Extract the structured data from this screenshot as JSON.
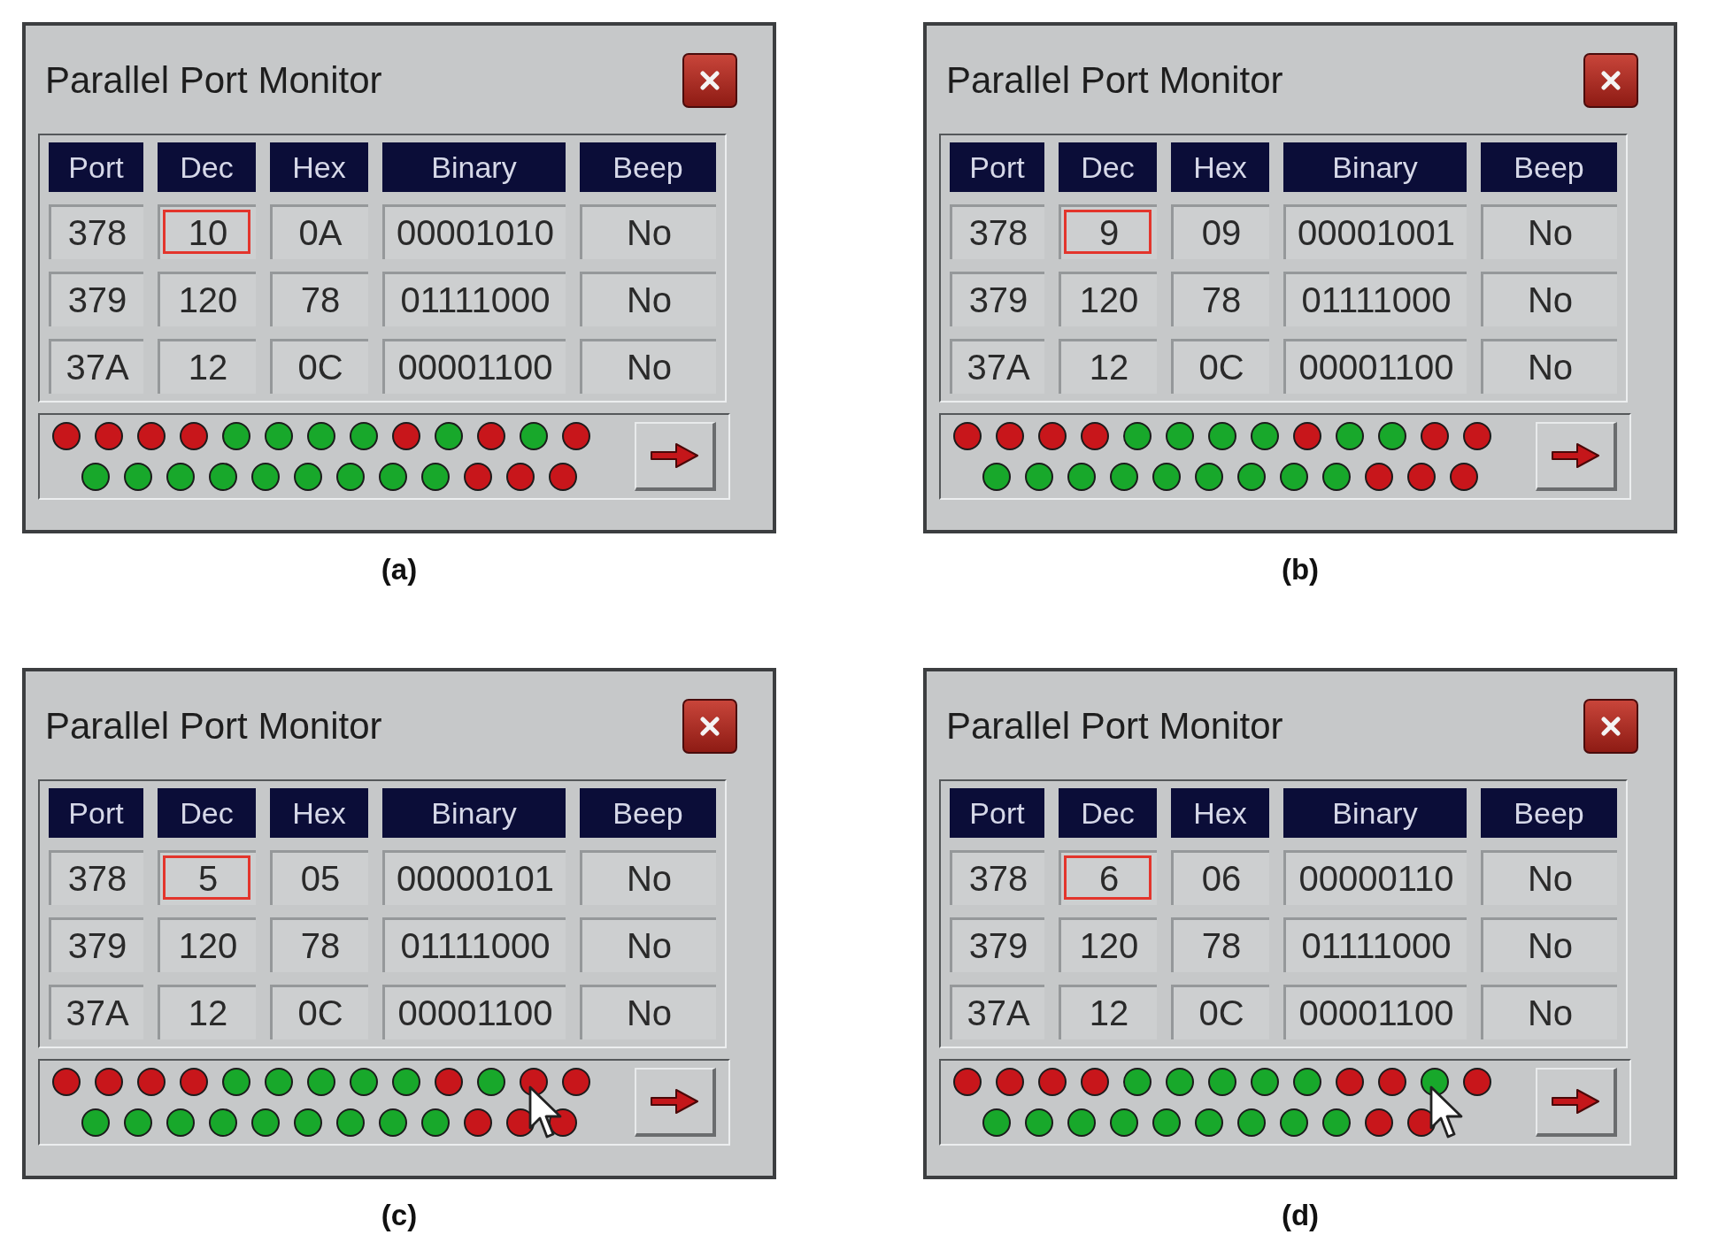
{
  "figures": [
    {
      "caption": "(a)",
      "window": {
        "title": "Parallel Port Monitor",
        "columns": [
          "Port",
          "Dec",
          "Hex",
          "Binary",
          "Beep"
        ],
        "rows": [
          {
            "port": "378",
            "dec": "10",
            "hex": "0A",
            "binary": "00001010",
            "beep": "No",
            "dec_highlighted": true
          },
          {
            "port": "379",
            "dec": "120",
            "hex": "78",
            "binary": "01111000",
            "beep": "No",
            "dec_highlighted": false
          },
          {
            "port": "37A",
            "dec": "12",
            "hex": "0C",
            "binary": "00001100",
            "beep": "No",
            "dec_highlighted": false
          }
        ],
        "leds_top": [
          {
            "color": "#c8161b",
            "hovered": false
          },
          {
            "color": "#c8161b",
            "hovered": false
          },
          {
            "color": "#c8161b",
            "hovered": false
          },
          {
            "color": "#c8161b",
            "hovered": false
          },
          {
            "color": "#18a82b",
            "hovered": false
          },
          {
            "color": "#18a82b",
            "hovered": false
          },
          {
            "color": "#18a82b",
            "hovered": false
          },
          {
            "color": "#18a82b",
            "hovered": false
          },
          {
            "color": "#c8161b",
            "hovered": false
          },
          {
            "color": "#18a82b",
            "hovered": false
          },
          {
            "color": "#c8161b",
            "hovered": false
          },
          {
            "color": "#18a82b",
            "hovered": false
          },
          {
            "color": "#c8161b",
            "hovered": false
          }
        ],
        "leds_bottom": [
          {
            "color": "#18a82b"
          },
          {
            "color": "#18a82b"
          },
          {
            "color": "#18a82b"
          },
          {
            "color": "#18a82b"
          },
          {
            "color": "#18a82b"
          },
          {
            "color": "#18a82b"
          },
          {
            "color": "#18a82b"
          },
          {
            "color": "#18a82b"
          },
          {
            "color": "#18a82b"
          },
          {
            "color": "#c8161b"
          },
          {
            "color": "#c8161b"
          },
          {
            "color": "#c8161b"
          }
        ]
      }
    },
    {
      "caption": "(b)",
      "window": {
        "title": "Parallel Port Monitor",
        "columns": [
          "Port",
          "Dec",
          "Hex",
          "Binary",
          "Beep"
        ],
        "rows": [
          {
            "port": "378",
            "dec": "9",
            "hex": "09",
            "binary": "00001001",
            "beep": "No",
            "dec_highlighted": true
          },
          {
            "port": "379",
            "dec": "120",
            "hex": "78",
            "binary": "01111000",
            "beep": "No",
            "dec_highlighted": false
          },
          {
            "port": "37A",
            "dec": "12",
            "hex": "0C",
            "binary": "00001100",
            "beep": "No",
            "dec_highlighted": false
          }
        ],
        "leds_top": [
          {
            "color": "#c8161b",
            "hovered": false
          },
          {
            "color": "#c8161b",
            "hovered": false
          },
          {
            "color": "#c8161b",
            "hovered": false
          },
          {
            "color": "#c8161b",
            "hovered": false
          },
          {
            "color": "#18a82b",
            "hovered": false
          },
          {
            "color": "#18a82b",
            "hovered": false
          },
          {
            "color": "#18a82b",
            "hovered": false
          },
          {
            "color": "#18a82b",
            "hovered": false
          },
          {
            "color": "#c8161b",
            "hovered": false
          },
          {
            "color": "#18a82b",
            "hovered": false
          },
          {
            "color": "#18a82b",
            "hovered": false
          },
          {
            "color": "#c8161b",
            "hovered": false
          },
          {
            "color": "#c8161b",
            "hovered": false
          }
        ],
        "leds_bottom": [
          {
            "color": "#18a82b"
          },
          {
            "color": "#18a82b"
          },
          {
            "color": "#18a82b"
          },
          {
            "color": "#18a82b"
          },
          {
            "color": "#18a82b"
          },
          {
            "color": "#18a82b"
          },
          {
            "color": "#18a82b"
          },
          {
            "color": "#18a82b"
          },
          {
            "color": "#18a82b"
          },
          {
            "color": "#c8161b"
          },
          {
            "color": "#c8161b"
          },
          {
            "color": "#c8161b"
          }
        ]
      }
    },
    {
      "caption": "(c)",
      "window": {
        "title": "Parallel Port Monitor",
        "columns": [
          "Port",
          "Dec",
          "Hex",
          "Binary",
          "Beep"
        ],
        "rows": [
          {
            "port": "378",
            "dec": "5",
            "hex": "05",
            "binary": "00000101",
            "beep": "No",
            "dec_highlighted": true
          },
          {
            "port": "379",
            "dec": "120",
            "hex": "78",
            "binary": "01111000",
            "beep": "No",
            "dec_highlighted": false
          },
          {
            "port": "37A",
            "dec": "12",
            "hex": "0C",
            "binary": "00001100",
            "beep": "No",
            "dec_highlighted": false
          }
        ],
        "leds_top": [
          {
            "color": "#c8161b",
            "hovered": false
          },
          {
            "color": "#c8161b",
            "hovered": false
          },
          {
            "color": "#c8161b",
            "hovered": false
          },
          {
            "color": "#c8161b",
            "hovered": false
          },
          {
            "color": "#18a82b",
            "hovered": false
          },
          {
            "color": "#18a82b",
            "hovered": false
          },
          {
            "color": "#18a82b",
            "hovered": false
          },
          {
            "color": "#18a82b",
            "hovered": false
          },
          {
            "color": "#18a82b",
            "hovered": false
          },
          {
            "color": "#c8161b",
            "hovered": false
          },
          {
            "color": "#18a82b",
            "hovered": false
          },
          {
            "color": "#c8161b",
            "hovered": true
          },
          {
            "color": "#c8161b",
            "hovered": false
          }
        ],
        "leds_bottom": [
          {
            "color": "#18a82b"
          },
          {
            "color": "#18a82b"
          },
          {
            "color": "#18a82b"
          },
          {
            "color": "#18a82b"
          },
          {
            "color": "#18a82b"
          },
          {
            "color": "#18a82b"
          },
          {
            "color": "#18a82b"
          },
          {
            "color": "#18a82b"
          },
          {
            "color": "#18a82b"
          },
          {
            "color": "#c8161b"
          },
          {
            "color": "#c8161b"
          },
          {
            "color": "#c8161b"
          }
        ]
      }
    },
    {
      "caption": "(d)",
      "window": {
        "title": "Parallel Port Monitor",
        "columns": [
          "Port",
          "Dec",
          "Hex",
          "Binary",
          "Beep"
        ],
        "rows": [
          {
            "port": "378",
            "dec": "6",
            "hex": "06",
            "binary": "00000110",
            "beep": "No",
            "dec_highlighted": true
          },
          {
            "port": "379",
            "dec": "120",
            "hex": "78",
            "binary": "01111000",
            "beep": "No",
            "dec_highlighted": false
          },
          {
            "port": "37A",
            "dec": "12",
            "hex": "0C",
            "binary": "00001100",
            "beep": "No",
            "dec_highlighted": false
          }
        ],
        "leds_top": [
          {
            "color": "#c8161b",
            "hovered": false
          },
          {
            "color": "#c8161b",
            "hovered": false
          },
          {
            "color": "#c8161b",
            "hovered": false
          },
          {
            "color": "#c8161b",
            "hovered": false
          },
          {
            "color": "#18a82b",
            "hovered": false
          },
          {
            "color": "#18a82b",
            "hovered": false
          },
          {
            "color": "#18a82b",
            "hovered": false
          },
          {
            "color": "#18a82b",
            "hovered": false
          },
          {
            "color": "#18a82b",
            "hovered": false
          },
          {
            "color": "#c8161b",
            "hovered": false
          },
          {
            "color": "#c8161b",
            "hovered": false
          },
          {
            "color": "#18a82b",
            "hovered": true
          },
          {
            "color": "#c8161b",
            "hovered": false
          }
        ],
        "leds_bottom": [
          {
            "color": "#18a82b"
          },
          {
            "color": "#18a82b"
          },
          {
            "color": "#18a82b"
          },
          {
            "color": "#18a82b"
          },
          {
            "color": "#18a82b"
          },
          {
            "color": "#18a82b"
          },
          {
            "color": "#18a82b"
          },
          {
            "color": "#18a82b"
          },
          {
            "color": "#18a82b"
          },
          {
            "color": "#c8161b"
          },
          {
            "color": "#c8161b"
          }
        ]
      }
    }
  ]
}
